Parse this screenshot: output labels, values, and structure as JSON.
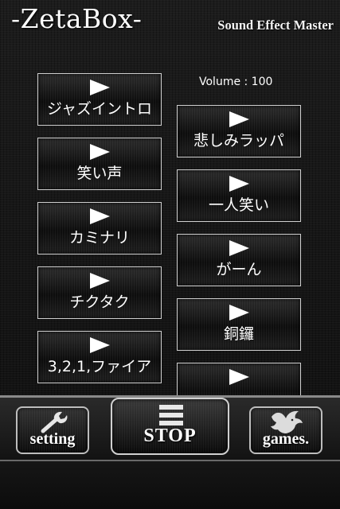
{
  "header": {
    "title": "-ZetaBox-",
    "subtitle": "Sound Effect Master"
  },
  "volume": {
    "label": "Volume : 100"
  },
  "sounds": {
    "left": [
      {
        "label": "ジャズイントロ"
      },
      {
        "label": "笑い声"
      },
      {
        "label": "カミナリ"
      },
      {
        "label": "チクタク"
      },
      {
        "label": "3,2,1,ファイア"
      }
    ],
    "right": [
      {
        "label": "悲しみラッパ"
      },
      {
        "label": "一人笑い"
      },
      {
        "label": "がーん"
      },
      {
        "label": "銅鑼"
      },
      {
        "label": ""
      }
    ]
  },
  "toolbar": {
    "setting_label": "setting",
    "stop_label": "STOP",
    "games_label": "games."
  },
  "icons": {
    "play": "play-triangle-icon",
    "setting": "wrench-icon",
    "stop": "stop-bars-icon",
    "games": "dragon-icon"
  }
}
